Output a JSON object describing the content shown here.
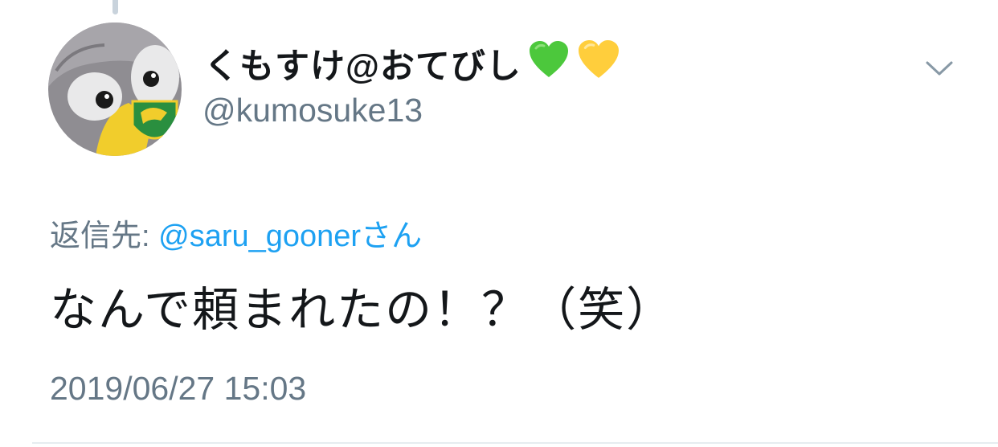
{
  "tweet": {
    "display_name": "くもすけ@おてびし",
    "name_emojis": [
      "green-heart",
      "yellow-heart"
    ],
    "handle": "@kumosuke13",
    "reply_prefix": "返信先: ",
    "reply_to": "@saru_gooner",
    "reply_suffix": "さん",
    "text": "なんで頼まれたの！？（笑）",
    "timestamp": "2019/06/27 15:03"
  },
  "icons": {
    "menu": "chevron-down-icon",
    "avatar": "owl-avatar"
  },
  "colors": {
    "link": "#1da1f2",
    "secondary_text": "#657786",
    "primary_text": "#14171a",
    "green_heart": "#4cc83c",
    "yellow_heart": "#ffce3c"
  }
}
